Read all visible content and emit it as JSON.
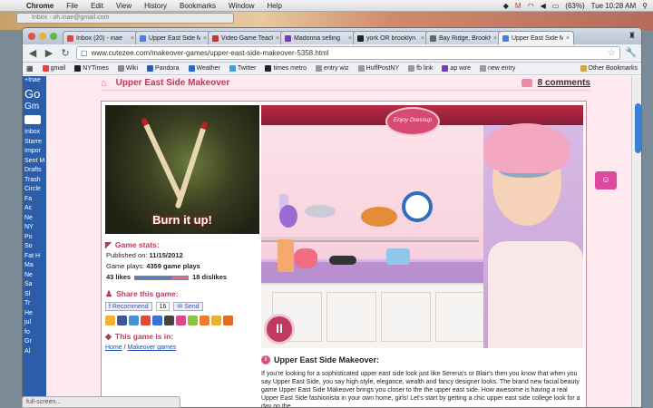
{
  "menubar": {
    "apple": "",
    "items": [
      "Chrome",
      "File",
      "Edit",
      "View",
      "History",
      "Bookmarks",
      "Window",
      "Help"
    ],
    "battery": "(63%)",
    "clock": "Tue 10:28 AM"
  },
  "background_window": {
    "title": "Inbox - oh.inae@gmail.com"
  },
  "browser": {
    "tabs": [
      {
        "title": "Inbox (20) - inae",
        "color": "#d44"
      },
      {
        "title": "Upper East Side M",
        "color": "#4a7fd6"
      },
      {
        "title": "Video Game Teach",
        "color": "#c33"
      },
      {
        "title": "Madonna selling",
        "color": "#7a3bb0"
      },
      {
        "title": "york OR brooklyn",
        "color": "#222"
      },
      {
        "title": "Bay Ridge, Brookly",
        "color": "#666"
      },
      {
        "title": "Upper East Side M",
        "color": "#4a7fd6"
      }
    ],
    "url": "www.cutezee.com/makeover-games/upper-east-side-makeover-5358.html",
    "bookmarks": [
      {
        "label": "gmail",
        "color": "#d44"
      },
      {
        "label": "NYTimes",
        "color": "#222"
      },
      {
        "label": "Wiki",
        "color": "#888"
      },
      {
        "label": "Pandora",
        "color": "#2a5ea8"
      },
      {
        "label": "Weather",
        "color": "#2b6cc4"
      },
      {
        "label": "Twitter",
        "color": "#3aa0e0"
      },
      {
        "label": "times metro",
        "color": "#222"
      },
      {
        "label": "entry wiz",
        "color": "#999"
      },
      {
        "label": "HuffPostNY",
        "color": "#999"
      },
      {
        "label": "fb link",
        "color": "#999"
      },
      {
        "label": "ap wire",
        "color": "#7a3bb0"
      },
      {
        "label": "new entry",
        "color": "#999"
      }
    ],
    "other_bookmarks": "Other Bookmarks"
  },
  "gmail_side": {
    "top": "+Inae",
    "logo": "Go",
    "label": "Gm",
    "items": [
      "Inbox",
      "Starre",
      "Impor",
      "Sent M",
      "Drafts",
      "Trash",
      "Circle",
      "Fa",
      "Ac",
      "Ne",
      "NY",
      "Po",
      "So",
      "Fat H",
      "Ma",
      "Ne",
      "Sa",
      "Sl",
      "Tr",
      "He",
      "jul",
      "fo",
      "Gr",
      "Al"
    ]
  },
  "page": {
    "title": "Upper East Side Makeover",
    "comments": "8 comments",
    "thumb_caption": "Burn it up!",
    "game_stats_heading": "Game stats:",
    "published_label": "Published on:",
    "published_value": "11/15/2012",
    "plays_label": "Game plays:",
    "plays_value": "4359 game plays",
    "likes": "43 likes",
    "dislikes": "18 dislikes",
    "like_ratio": 0.7,
    "share_heading": "Share this game:",
    "recommend": "Recommend",
    "recommend_count": "16",
    "send": "Send",
    "game_in_heading": "This game is in:",
    "crumb_home": "Home",
    "crumb_sep": " / ",
    "crumb_category": "Makeover games",
    "game_sign": "Enjoy Dressup",
    "pause_label": "II",
    "desc_heading": "Upper East Side Makeover:",
    "desc_body": "If you're looking for a sophisticated upper east side look just like Serena's or Blair's then you know that when you say Upper East Side, you say high style, elegance, wealth and fancy designer looks. The brand new facial beauty game Upper East Side Makeover brings you closer to the the upper east side. How awesome is having a real Upper East Side fashionista in your own home, girls! Let's start by getting a chic upper east side college look for a day on the"
  },
  "statusbar": {
    "text": "full-screen..."
  },
  "colors": {
    "accent": "#c0395e",
    "pink_bg": "#fde9ee",
    "gmail_blue": "#2c5da8"
  },
  "share_icons": [
    "#f2b233",
    "#3b5998",
    "#4a90d9",
    "#dd4b39",
    "#3a6fd8",
    "#444",
    "#d94a8c",
    "#8cc63f",
    "#f07b2a",
    "#e8b12b",
    "#e06a2a"
  ]
}
